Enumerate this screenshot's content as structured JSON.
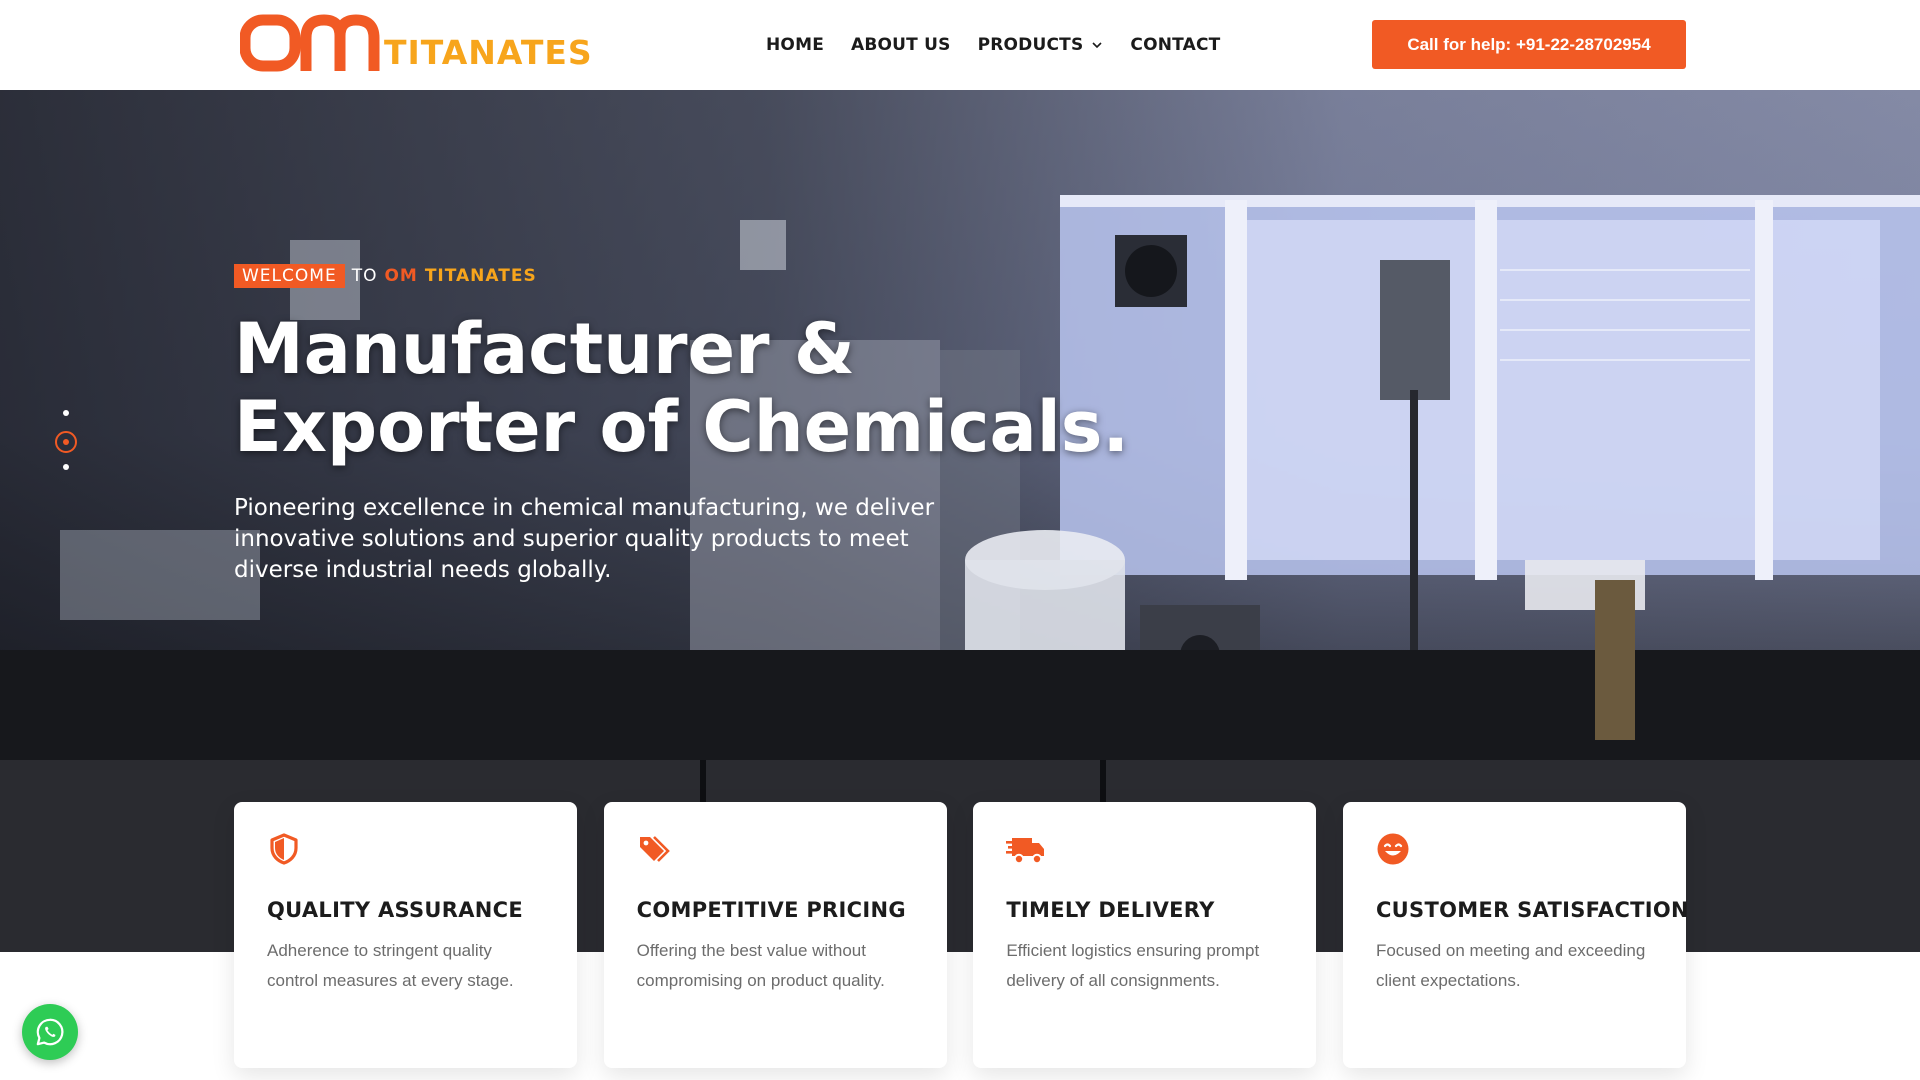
{
  "brand": {
    "logo_om": "OM",
    "logo_name": "TITANATES",
    "colors": {
      "primary": "#f15a24",
      "secondary": "#f7a51c",
      "dark": "#1b1b1b"
    }
  },
  "nav": {
    "items": [
      {
        "label": "HOME"
      },
      {
        "label": "ABOUT US"
      },
      {
        "label": "PRODUCTS",
        "icon": "chevron-down-icon"
      },
      {
        "label": "CONTACT"
      }
    ]
  },
  "call_button": {
    "label": "Call for help: +91-22-28702954"
  },
  "hero": {
    "kicker": {
      "welcome": "WELCOME",
      "to": "TO",
      "om": "OM",
      "titanates": "TITANATES"
    },
    "title_line1": "Manufacturer &",
    "title_line2": "Exporter of Chemicals.",
    "subtitle": "Pioneering excellence in chemical manufacturing, we deliver innovative solutions and superior quality products to meet diverse industrial needs globally.",
    "slides": {
      "count": 3,
      "active": 2
    }
  },
  "features": [
    {
      "icon": "shield-icon",
      "title": "QUALITY ASSURANCE",
      "text": "Adherence to stringent quality control measures at every stage."
    },
    {
      "icon": "price-tag-icon",
      "title": "COMPETITIVE PRICING",
      "text": "Offering the best value without compromising on product quality."
    },
    {
      "icon": "delivery-truck-icon",
      "title": "TIMELY DELIVERY",
      "text": "Efficient logistics ensuring prompt delivery of all consignments."
    },
    {
      "icon": "smile-icon",
      "title": "CUSTOMER SATISFACTION",
      "text": "Focused on meeting and exceeding client expectations."
    }
  ],
  "whatsapp": {
    "icon": "whatsapp-icon"
  }
}
